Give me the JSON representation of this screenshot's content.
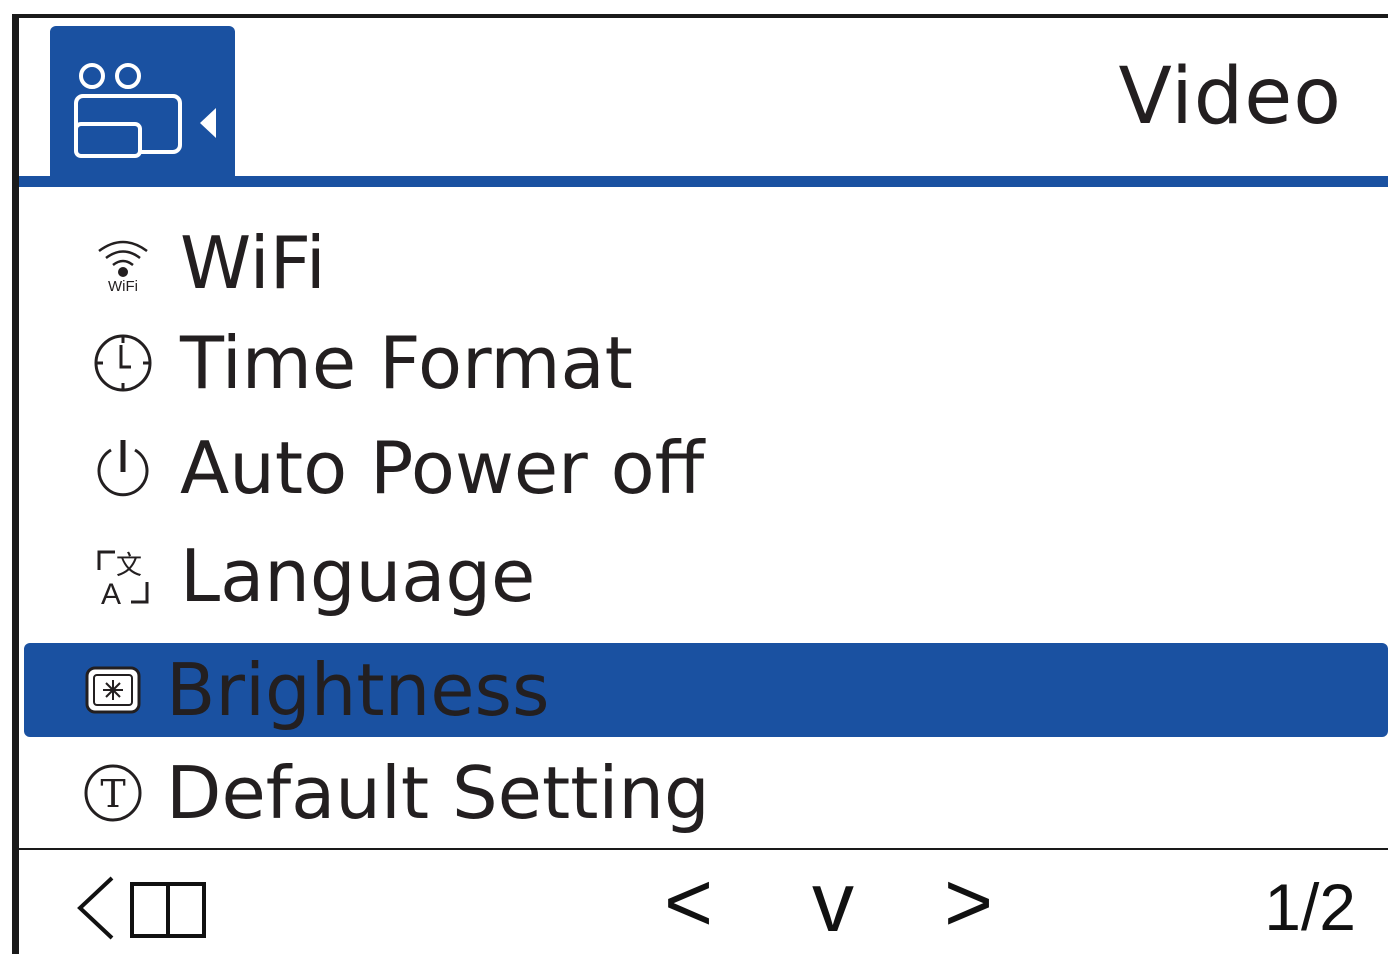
{
  "header": {
    "mode_icon": "video-camera-icon",
    "title": "Video"
  },
  "menu": {
    "items": [
      {
        "label": "WiFi",
        "icon": "wifi-icon",
        "selected": false
      },
      {
        "label": "Time Format",
        "icon": "clock-icon",
        "selected": false
      },
      {
        "label": "Auto Power off",
        "icon": "power-icon",
        "selected": false
      },
      {
        "label": "Language",
        "icon": "language-icon",
        "selected": false
      },
      {
        "label": "Brightness",
        "icon": "brightness-icon",
        "selected": true
      },
      {
        "label": "Default Setting",
        "icon": "default-setting-icon",
        "selected": false
      }
    ]
  },
  "footer": {
    "back_icon": "back-icon",
    "prev_symbol": "<",
    "confirm_symbol": "v",
    "next_symbol": ">",
    "page_indicator": "1/2"
  },
  "colors": {
    "accent": "#1a51a1",
    "text": "#231f20",
    "background": "#ffffff"
  }
}
